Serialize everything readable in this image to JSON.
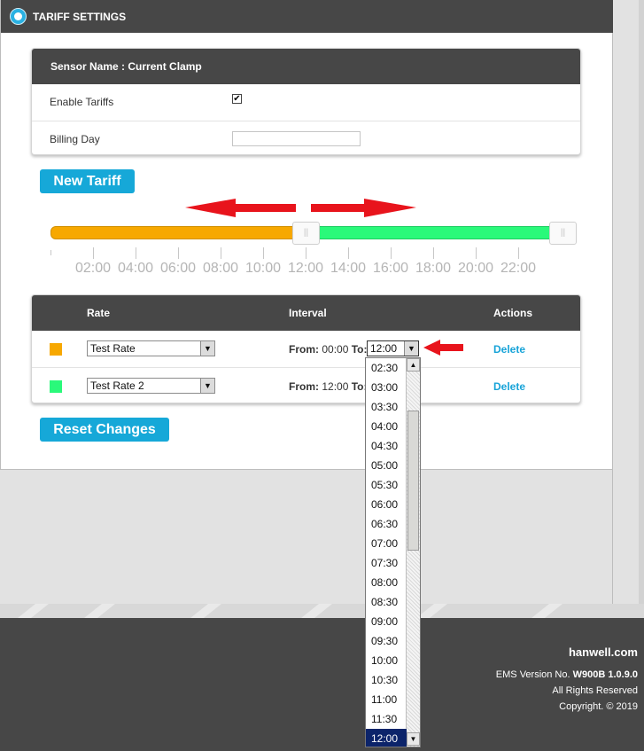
{
  "panel": {
    "title": "TARIFF SETTINGS"
  },
  "sensor": {
    "name_label": "Sensor Name : Current Clamp",
    "enable_label": "Enable Tariffs",
    "enable_checked": "✔",
    "billing_label": "Billing Day",
    "billing_value": ""
  },
  "buttons": {
    "new_tariff": "New Tariff",
    "reset": "Reset Changes"
  },
  "timeline": {
    "split_value": "12:00",
    "ticks": [
      "02:00",
      "04:00",
      "06:00",
      "08:00",
      "10:00",
      "12:00",
      "14:00",
      "16:00",
      "18:00",
      "20:00",
      "22:00"
    ],
    "colors": {
      "rate1": "#f7a800",
      "rate2": "#2af97a",
      "arrow": "#e8141c"
    }
  },
  "table": {
    "headers": {
      "rate": "Rate",
      "interval": "Interval",
      "actions": "Actions"
    },
    "rows": [
      {
        "rate": "Test Rate",
        "from_label": "From:",
        "from_value": "00:00",
        "to_label": "To:",
        "to_value": "12:00",
        "action": "Delete"
      },
      {
        "rate": "Test Rate 2",
        "from_label": "From:",
        "from_value": "12:00",
        "to_label": "To:",
        "to_value": "",
        "action": "Delete"
      }
    ]
  },
  "dropdown": {
    "options": [
      "02:30",
      "03:00",
      "03:30",
      "04:00",
      "04:30",
      "05:00",
      "05:30",
      "06:00",
      "06:30",
      "07:00",
      "07:30",
      "08:00",
      "08:30",
      "09:00",
      "09:30",
      "10:00",
      "10:30",
      "11:00",
      "11:30",
      "12:00"
    ],
    "selected": "12:00"
  },
  "footer": {
    "site": "hanwell.com",
    "version_label": "EMS Version No.",
    "version_value": "W900B 1.0.9.0",
    "rights": "All Rights Reserved",
    "copyright": "Copyright. © 2019"
  }
}
